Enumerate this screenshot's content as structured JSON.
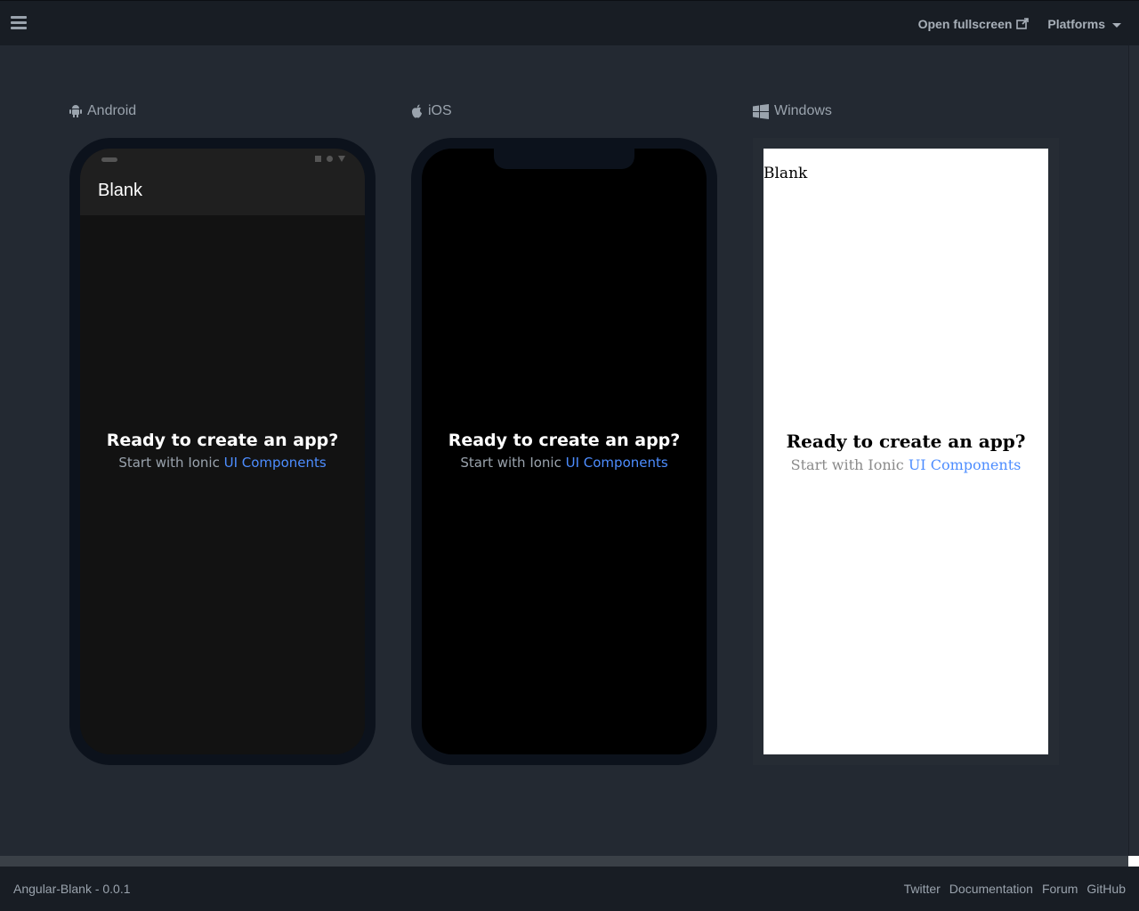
{
  "topbar": {
    "open_fullscreen": "Open fullscreen",
    "platforms": "Platforms"
  },
  "platforms": {
    "android": "Android",
    "ios": "iOS",
    "windows": "Windows"
  },
  "app": {
    "title": "Blank",
    "ready": "Ready to create an app?",
    "start_prefix": "Start with Ionic ",
    "components_link": "UI Components"
  },
  "footer": {
    "app_name": "Angular-Blank - 0.0.1",
    "links": [
      "Twitter",
      "Documentation",
      "Forum",
      "GitHub"
    ]
  },
  "colors": {
    "link": "#4d8dff",
    "background": "#232932",
    "bar": "#181d24"
  }
}
